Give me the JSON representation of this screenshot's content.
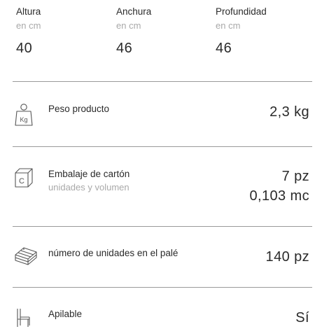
{
  "dimensions": [
    {
      "label": "Altura",
      "unit": "en cm",
      "value": "40"
    },
    {
      "label": "Anchura",
      "unit": "en cm",
      "value": "46"
    },
    {
      "label": "Profundidad",
      "unit": "en cm",
      "value": "46"
    }
  ],
  "rows": {
    "weight": {
      "icon": "weight-kg-icon",
      "icon_text": "Kg",
      "title": "Peso producto",
      "value": "2,3 kg"
    },
    "carton": {
      "icon": "carton-box-icon",
      "icon_text": "C",
      "title": "Embalaje de cartón",
      "subtitle": "unidades y volumen",
      "value_units": "7 pz",
      "value_volume": "0,103 mc"
    },
    "pallet": {
      "icon": "pallet-icon",
      "title": "número de unidades en el palé",
      "value": "140 pz"
    },
    "stackable": {
      "icon": "stacked-chairs-icon",
      "title": "Apilable",
      "value": "Sí"
    }
  },
  "colors": {
    "text": "#2a2a2a",
    "muted": "#a9a9a9",
    "divider": "#9a9a9a",
    "icon": "#555555"
  }
}
